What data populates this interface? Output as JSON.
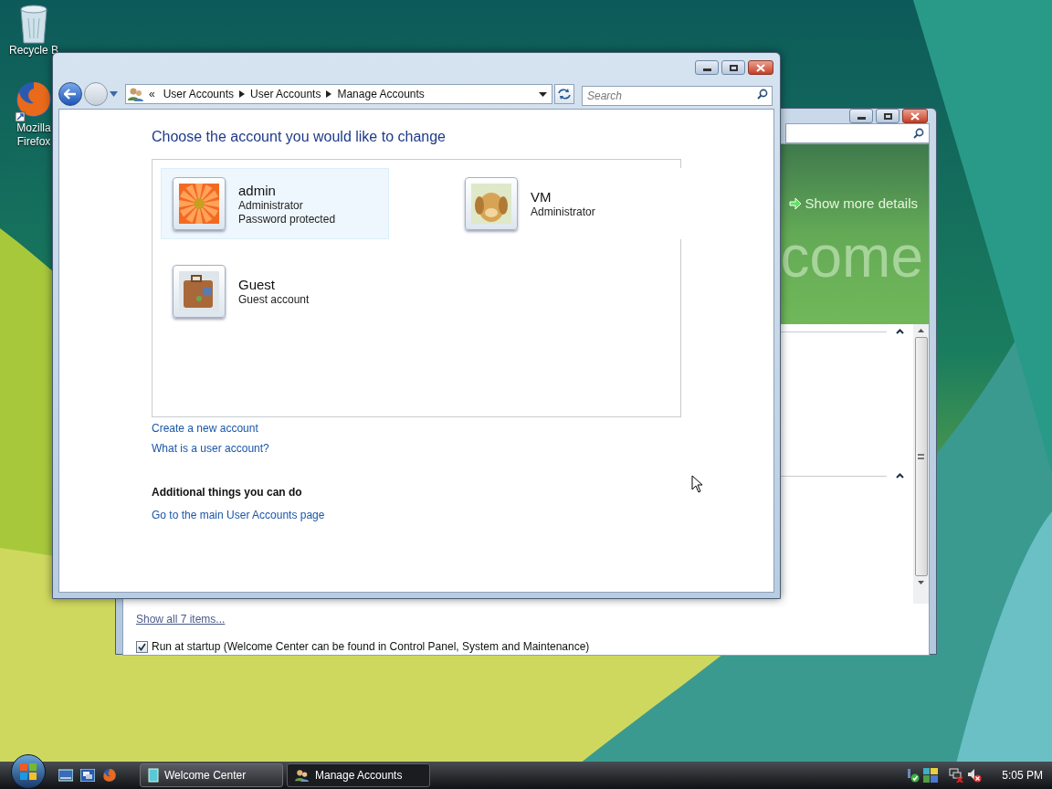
{
  "desktop": {
    "icons": [
      {
        "kind": "bin",
        "label": "Recycle B"
      },
      {
        "kind": "firefox",
        "label": "Mozilla Firefox"
      }
    ]
  },
  "back_window": {
    "banner": {
      "link": "Show more details",
      "title": "come"
    },
    "sections": [
      {
        "expanded": true
      },
      {
        "expanded": true
      }
    ],
    "show_all_link": "Show all 7 items...",
    "startup": {
      "label": "Run at startup (Welcome Center can be found in Control Panel, System and Maintenance)",
      "checked": true
    }
  },
  "front_window": {
    "overflow": "«",
    "breadcrumb": [
      "User Accounts",
      "User Accounts",
      "Manage Accounts"
    ],
    "search": {
      "placeholder": "Search"
    },
    "heading": "Choose the account you would like to change",
    "accounts": [
      {
        "kind": "flower",
        "name": "admin",
        "details": [
          "Administrator",
          "Password protected"
        ],
        "selected": true
      },
      {
        "kind": "dog",
        "name": "VM",
        "details": [
          "Administrator"
        ],
        "selected": false
      },
      {
        "kind": "suitcase",
        "name": "Guest",
        "details": [
          "Guest account"
        ],
        "selected": false
      }
    ],
    "links": [
      "Create a new account",
      "What is a user account?"
    ],
    "additional": {
      "title": "Additional things you can do",
      "links": [
        "Go to the main User Accounts page"
      ]
    }
  },
  "taskbar": {
    "buttons": [
      {
        "kind": "welcome",
        "label": "Welcome Center",
        "selected": false
      },
      {
        "kind": "accounts",
        "label": "Manage Accounts",
        "selected": true
      }
    ],
    "clock": "5:05 PM"
  }
}
